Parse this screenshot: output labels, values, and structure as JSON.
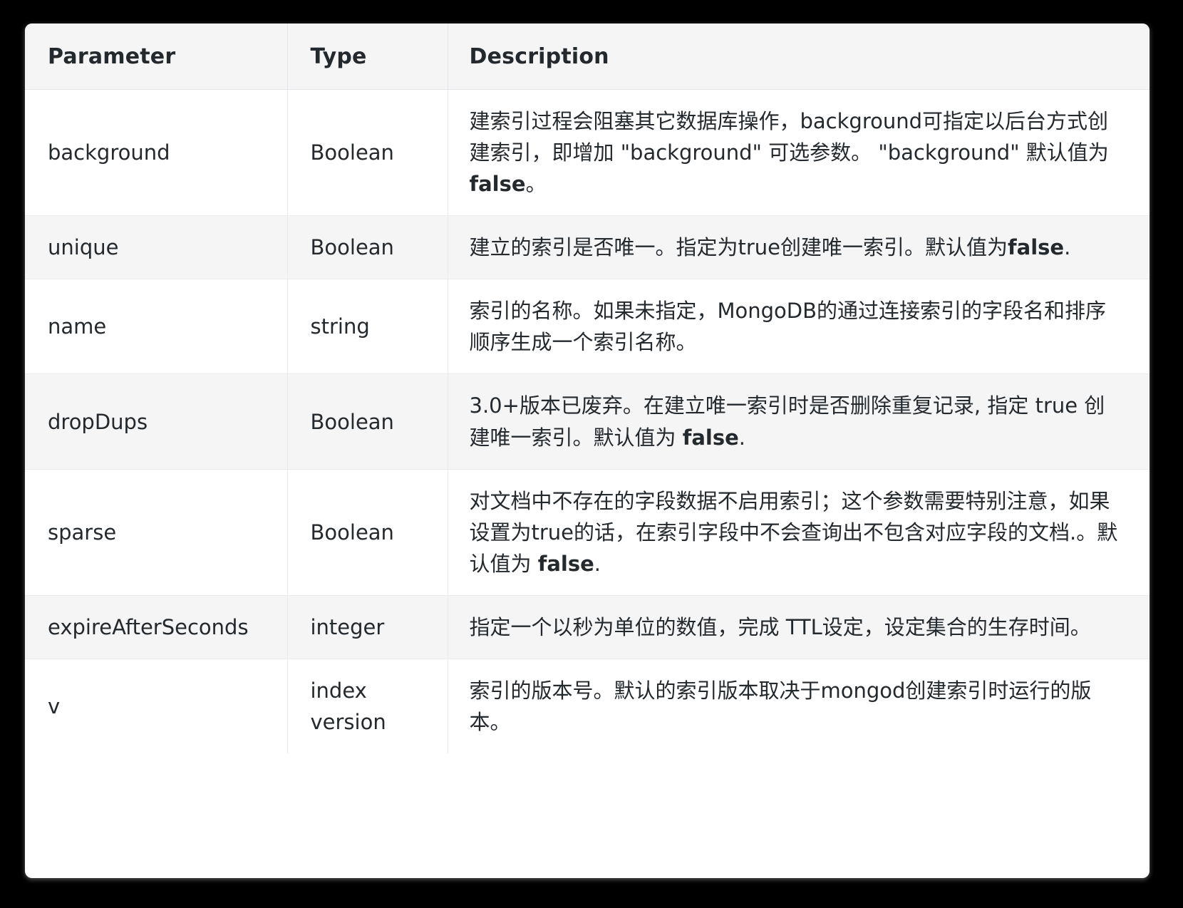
{
  "table": {
    "headers": {
      "parameter": "Parameter",
      "type": "Type",
      "description": "Description"
    },
    "rows": [
      {
        "parameter": "background",
        "type": "Boolean",
        "description": "建索引过程会阻塞其它数据库操作，background可指定以后台方式创建索引，即增加 \"background\" 可选参数。 \"background\" 默认值为",
        "description_bold": "false",
        "description_tail": "。"
      },
      {
        "parameter": "unique",
        "type": "Boolean",
        "description": "建立的索引是否唯一。指定为true创建唯一索引。默认值为",
        "description_bold": "false",
        "description_tail": "."
      },
      {
        "parameter": "name",
        "type": "string",
        "description": "索引的名称。如果未指定，MongoDB的通过连接索引的字段名和排序顺序生成一个索引名称。",
        "description_bold": "",
        "description_tail": ""
      },
      {
        "parameter": "dropDups",
        "type": "Boolean",
        "description": "3.0+版本已废弃。在建立唯一索引时是否删除重复记录, 指定 true 创建唯一索引。默认值为 ",
        "description_bold": "false",
        "description_tail": "."
      },
      {
        "parameter": "sparse",
        "type": "Boolean",
        "description": "对文档中不存在的字段数据不启用索引；这个参数需要特别注意，如果设置为true的话，在索引字段中不会查询出不包含对应字段的文档.。默认值为 ",
        "description_bold": "false",
        "description_tail": "."
      },
      {
        "parameter": "expireAfterSeconds",
        "type": "integer",
        "description": "指定一个以秒为单位的数值，完成 TTL设定，设定集合的生存时间。",
        "description_bold": "",
        "description_tail": ""
      },
      {
        "parameter": "v",
        "type": "index version",
        "description": "索引的版本号。默认的索引版本取决于mongod创建索引时运行的版本。",
        "description_bold": "",
        "description_tail": ""
      }
    ]
  },
  "colors": {
    "page_background": "#000000",
    "card_background": "#ffffff",
    "header_background": "#f5f5f6",
    "stripe_background": "#f5f5f6",
    "border": "#e9ecef",
    "text": "#24292e"
  }
}
